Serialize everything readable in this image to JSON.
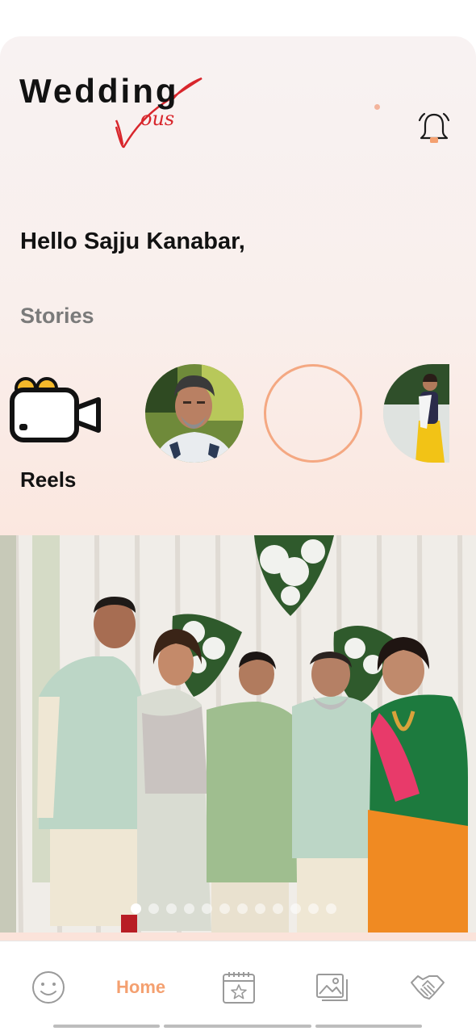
{
  "header": {
    "logo_word": "Wedding",
    "logo_script": "ous",
    "logo_initial": "V"
  },
  "greeting": "Hello Sajju Kanabar,",
  "stories": {
    "title": "Stories",
    "reels_label": "Reels",
    "items": [
      {
        "kind": "photo",
        "icon": "user-avatar"
      },
      {
        "kind": "empty-ring",
        "icon": "story-ring"
      },
      {
        "kind": "photo",
        "icon": "user-avatar"
      }
    ]
  },
  "carousel": {
    "total_pages": 12,
    "active_index": 0
  },
  "nav": {
    "home_label": "Home",
    "items": [
      "smiley-icon",
      "home",
      "calendar-star-icon",
      "gallery-icon",
      "handshake-icon"
    ]
  },
  "colors": {
    "accent": "#f4a070",
    "logo_red": "#d8262c",
    "text_dark": "#121212",
    "stories_grey": "#7a7a7a"
  }
}
